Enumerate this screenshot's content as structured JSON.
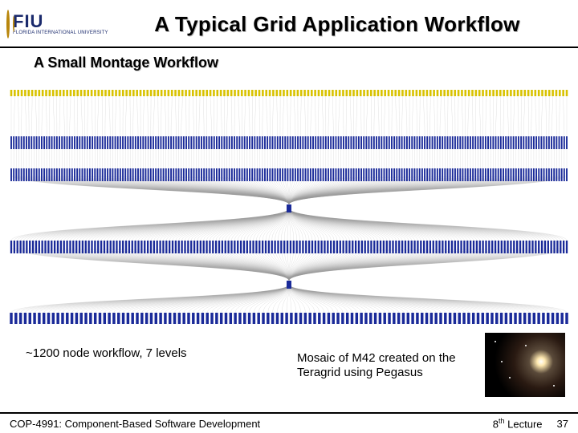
{
  "logo": {
    "acronym": "FIU",
    "full": "FLORIDA INTERNATIONAL UNIVERSITY"
  },
  "title": "A Typical Grid Application Workflow",
  "subtitle": "A Small Montage Workflow",
  "caption_left": "~1200 node workflow, 7 levels",
  "caption_right": "Mosaic of M42 created on the Teragrid using Pegasus",
  "footer": {
    "left": "COP-4991: Component-Based Software Development",
    "right_prefix": "8",
    "right_ord": "th",
    "right_suffix": " Lecture",
    "page": "37"
  },
  "colors": {
    "node_blue": "#1a2a99",
    "top_yellow": "#d8c200",
    "edge_gray": "#444"
  }
}
